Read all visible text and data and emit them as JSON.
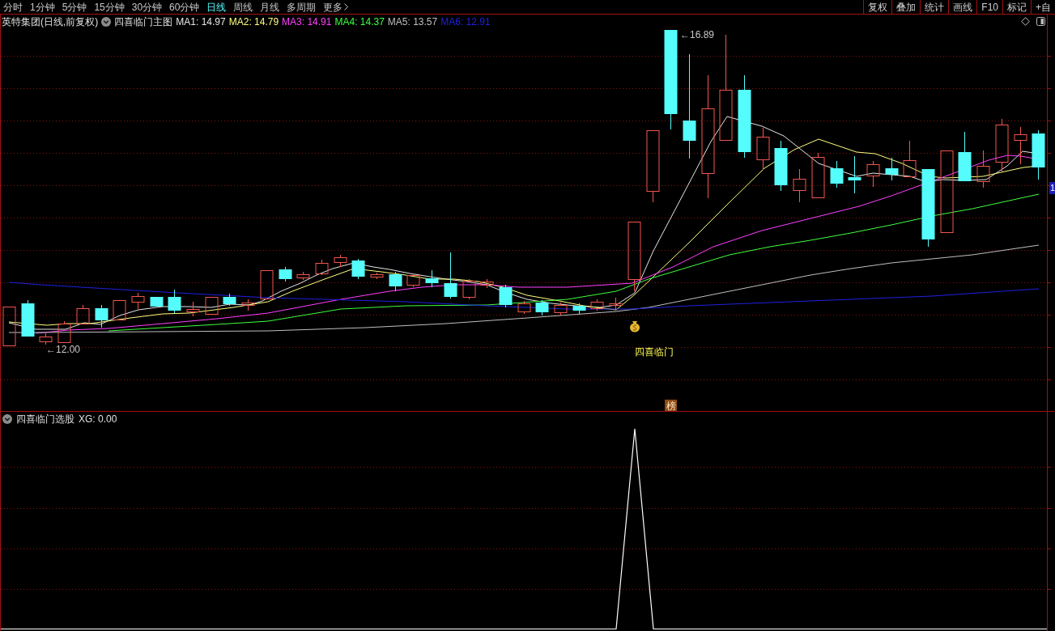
{
  "toolbar": {
    "periods": [
      {
        "label": "分时",
        "selected": false
      },
      {
        "label": "1分钟",
        "selected": false
      },
      {
        "label": "5分钟",
        "selected": false
      },
      {
        "label": "15分钟",
        "selected": false
      },
      {
        "label": "30分钟",
        "selected": false
      },
      {
        "label": "60分钟",
        "selected": false
      },
      {
        "label": "日线",
        "selected": true
      },
      {
        "label": "周线",
        "selected": false
      },
      {
        "label": "月线",
        "selected": false
      },
      {
        "label": "多周期",
        "selected": false
      }
    ],
    "more": "更多",
    "buttons": [
      "复权",
      "叠加",
      "统计",
      "画线",
      "F10",
      "标记",
      "+自"
    ]
  },
  "main_panel": {
    "title": "英特集团(日线,前复权)",
    "indicator": "四喜临门主图",
    "moving_averages": [
      {
        "label": "MA1: 14.97",
        "color": "#e6e6e6"
      },
      {
        "label": "MA2: 14.79",
        "color": "#ffff80"
      },
      {
        "label": "MA3: 14.91",
        "color": "#ff40ff"
      },
      {
        "label": "MA4: 14.37",
        "color": "#40ff40"
      },
      {
        "label": "MA5: 13.57",
        "color": "#bfbfbf"
      },
      {
        "label": "MA6: 12.91",
        "color": "#2020e0"
      }
    ],
    "high_label": "←16.89",
    "low_label": "←12.00",
    "signal_label": "四喜临门",
    "badge": "榜",
    "axis_marker": "1"
  },
  "sub_panel": {
    "title": "四喜临门选股",
    "reading": "XG: 0.00"
  }
}
